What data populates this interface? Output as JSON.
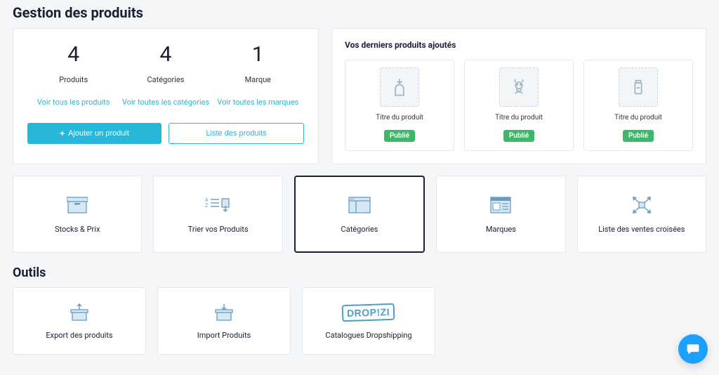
{
  "header": {
    "title": "Gestion des produits"
  },
  "stats": {
    "items": [
      {
        "value": "4",
        "label": "Produits",
        "link": "Voir tous les produits"
      },
      {
        "value": "4",
        "label": "Catégories",
        "link": "Voir toutes les catégories"
      },
      {
        "value": "1",
        "label": "Marque",
        "link": "Voir toutes les marques"
      }
    ],
    "add_button": "Ajouter un produit",
    "list_button": "Liste des produits"
  },
  "recent": {
    "heading": "Vos derniers produits ajoutés",
    "items": [
      {
        "title": "Titre du produit",
        "status": "Publié"
      },
      {
        "title": "Titre du produit",
        "status": "Publié"
      },
      {
        "title": "Titre du produit",
        "status": "Publié"
      }
    ]
  },
  "tiles": [
    {
      "label": "Stocks & Prix"
    },
    {
      "label": "Trier vos Produits"
    },
    {
      "label": "Catégories"
    },
    {
      "label": "Marques"
    },
    {
      "label": "Liste des ventes croisées"
    }
  ],
  "tools": {
    "heading": "Outils",
    "items": [
      {
        "label": "Export des produits"
      },
      {
        "label": "Import Produits"
      },
      {
        "label": "Catalogues Dropshipping"
      }
    ]
  },
  "colors": {
    "accent": "#27b7d8",
    "success": "#3db86b",
    "icon_fill": "#d5e9f5",
    "icon_stroke": "#6b9bc2"
  }
}
